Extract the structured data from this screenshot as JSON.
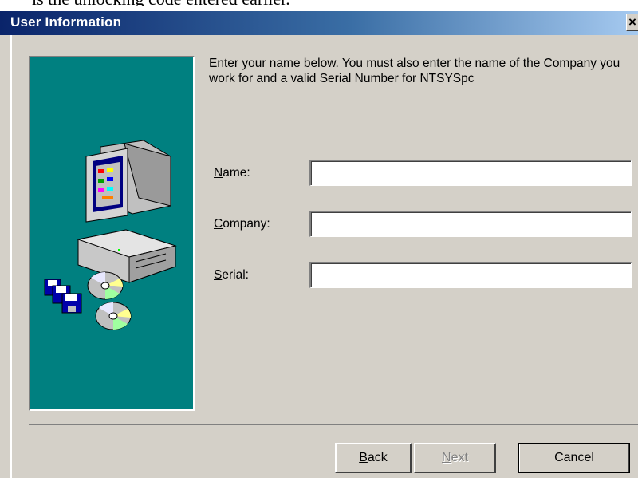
{
  "background_text": "is the unlocking code entered earlier.",
  "window": {
    "title": "User Information",
    "close_glyph": "×",
    "title_gradient": [
      "#0a246a",
      "#a6caf0"
    ]
  },
  "intro_text": "Enter your name below.  You must also enter the name of the Company you work for and a valid Serial Number for NTSYSpc",
  "form": {
    "name_label_key": "N",
    "name_label_rest": "ame:",
    "name_value": "",
    "company_label_key": "C",
    "company_label_rest": "ompany:",
    "company_value": "",
    "serial_label_key": "S",
    "serial_label_rest": "erial:",
    "serial_value": ""
  },
  "buttons": {
    "back_key": "B",
    "back_rest": "ack",
    "next_key": "N",
    "next_rest": "ext",
    "cancel": "Cancel"
  },
  "panel": {
    "color": "#008080",
    "icons": [
      "computer-icon",
      "floppy-disks-icon",
      "cd-icon",
      "cd-icon"
    ]
  }
}
